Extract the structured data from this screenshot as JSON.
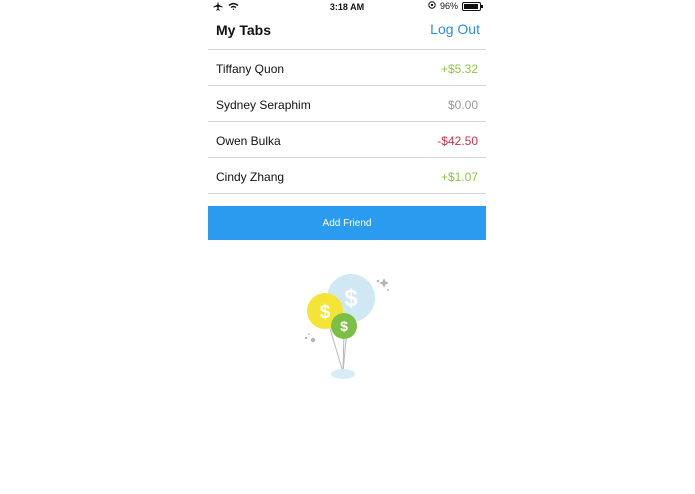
{
  "status_bar": {
    "time": "3:18 AM",
    "battery": "96%",
    "battery_level": 0.96
  },
  "header": {
    "title": "My Tabs",
    "logout_label": "Log Out"
  },
  "friends": [
    {
      "name": "Tiffany Quon",
      "amount": "+$5.32",
      "color": "#8cc63f"
    },
    {
      "name": "Sydney Seraphim",
      "amount": "$0.00",
      "color": "#9a9a9a"
    },
    {
      "name": "Owen Bulka",
      "amount": "-$42.50",
      "color": "#c8324a"
    },
    {
      "name": "Cindy Zhang",
      "amount": "+$1.07",
      "color": "#8cc63f"
    }
  ],
  "add_button": {
    "label": "Add Friend",
    "color": "#2a9bef"
  },
  "illustration": {
    "icons": [
      "dollar-balloon-icon"
    ],
    "glyph": "$"
  }
}
